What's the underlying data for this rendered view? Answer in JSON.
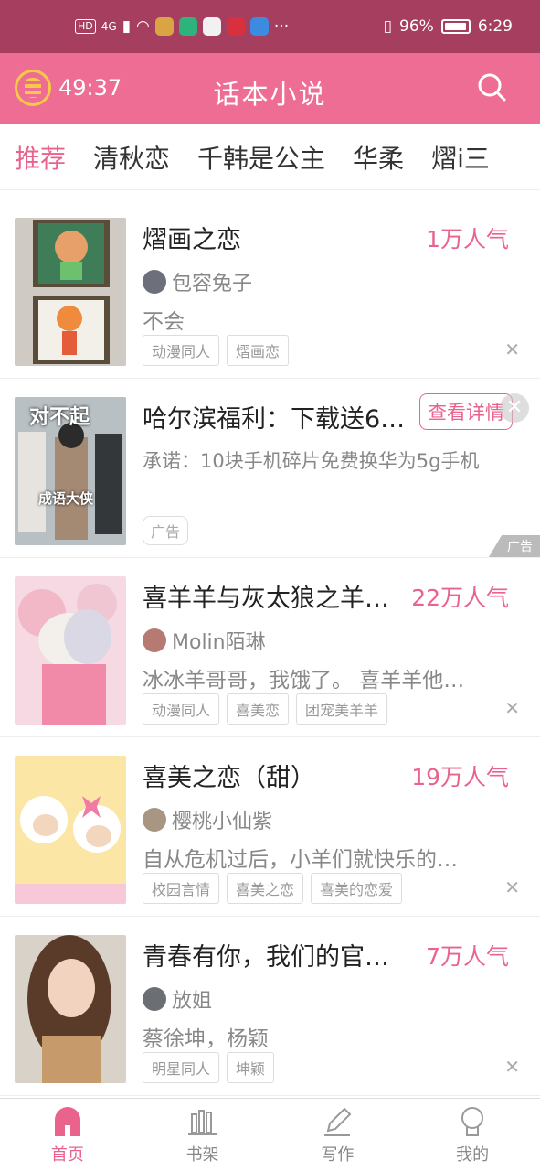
{
  "status_bar": {
    "hd": "HD",
    "network": "4G",
    "battery": "96%",
    "time": "6:29",
    "more": "···"
  },
  "header": {
    "timer": "49:37",
    "title": "话本小说"
  },
  "tabs": [
    "推荐",
    "清秋恋",
    "千韩是公主",
    "华柔",
    "熠i三"
  ],
  "feed": [
    {
      "title": "熠画之恋",
      "heat": "1万人气",
      "author": "包容兔子",
      "summary": "不会",
      "tags": [
        "动漫同人",
        "熠画恋"
      ]
    },
    {
      "ad": true,
      "cover_text_top": "对不起",
      "cover_text_bottom": "成语大侠",
      "title": "哈尔滨福利：下载送6…",
      "button": "查看详情",
      "description": "承诺：10块手机碎片免费换华为5g手机",
      "tag": "广告",
      "mark": "广告"
    },
    {
      "title": "喜羊羊与灰太狼之羊…",
      "heat": "22万人气",
      "author": "Molin陌琳",
      "summary": "冰冰羊哥哥，我饿了。 喜羊羊他…",
      "tags": [
        "动漫同人",
        "喜美恋",
        "团宠美羊羊"
      ]
    },
    {
      "title": "喜美之恋（甜）",
      "heat": "19万人气",
      "author": "樱桃小仙紫",
      "summary": "自从危机过后，小羊们就快乐的…",
      "tags": [
        "校园言情",
        "喜美之恋",
        "喜美的恋爱"
      ]
    },
    {
      "title": "青春有你，我们的官…",
      "heat": "7万人气",
      "author": "放姐",
      "summary": "蔡徐坤，杨颖",
      "tags": [
        "明星同人",
        "坤颖"
      ]
    }
  ],
  "bottom_nav": [
    "首页",
    "书架",
    "写作",
    "我的"
  ],
  "colors": {
    "brand": "#ee6d94",
    "status_bar": "#a53e5f",
    "accent": "#e9638d"
  }
}
